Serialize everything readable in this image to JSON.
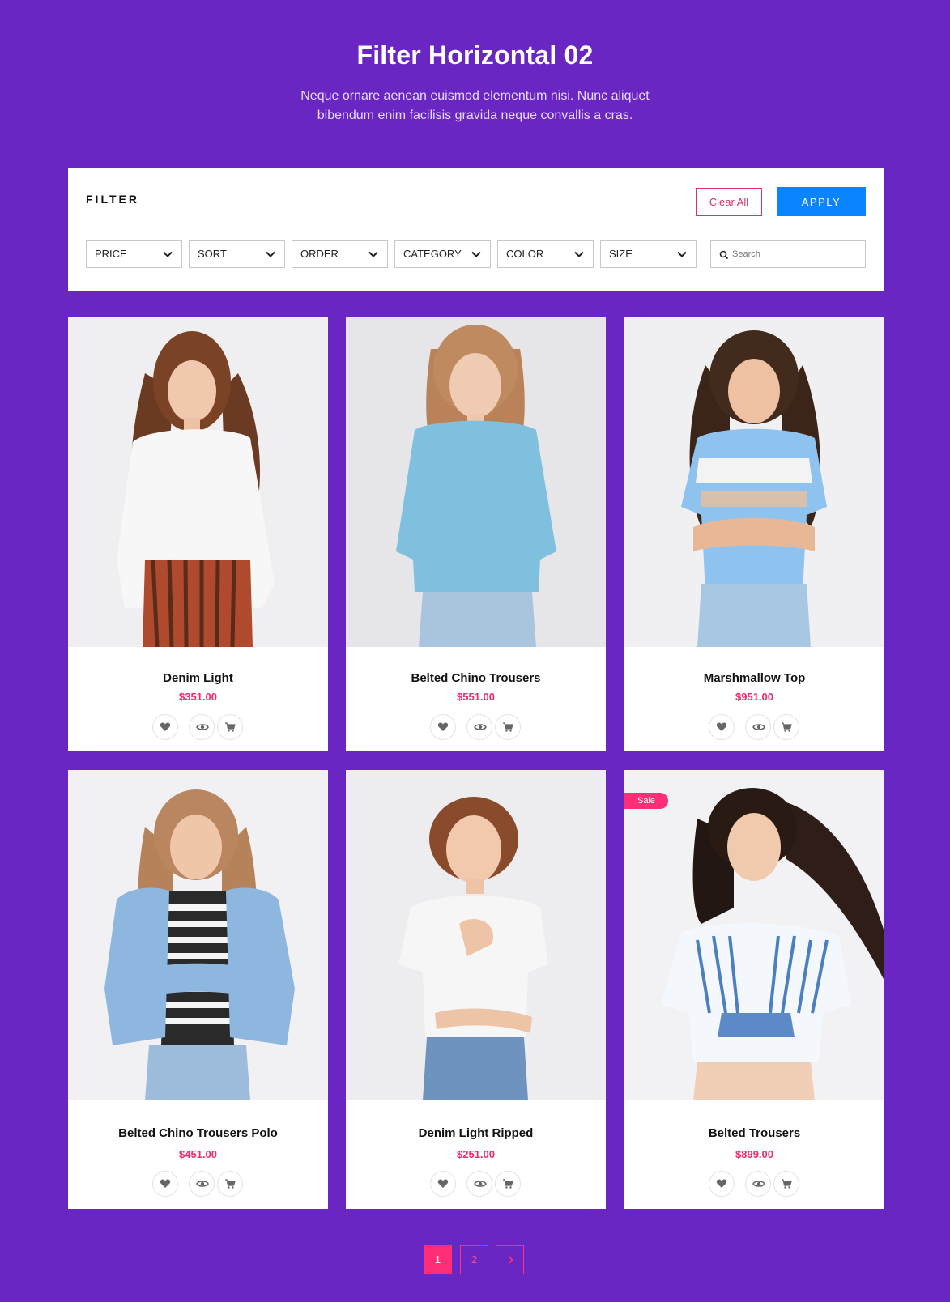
{
  "header": {
    "title": "Filter Horizontal 02",
    "subtitle": "Neque ornare aenean euismod elementum nisi. Nunc aliquet bibendum enim facilisis gravida neque convallis a cras."
  },
  "filter": {
    "title": "FILTER",
    "clear_label": "Clear All",
    "apply_label": "APPLY",
    "selects": [
      "PRICE",
      "SORT",
      "ORDER",
      "CATEGORY",
      "COLOR",
      "SIZE"
    ],
    "search_placeholder": "Search"
  },
  "products": [
    {
      "name": "Denim Light",
      "price": "$351.00",
      "sale": ""
    },
    {
      "name": "Belted Chino Trousers",
      "price": "$551.00",
      "sale": ""
    },
    {
      "name": "Marshmallow Top",
      "price": "$951.00",
      "sale": ""
    },
    {
      "name": "Belted Chino Trousers Polo",
      "price": "$451.00",
      "sale": ""
    },
    {
      "name": "Denim Light Ripped",
      "price": "$251.00",
      "sale": ""
    },
    {
      "name": "Belted Trousers",
      "price": "$899.00",
      "sale": "Sale"
    }
  ],
  "pagination": {
    "pages": [
      "1",
      "2"
    ],
    "active": "1",
    "next_icon": "chevron-right-icon"
  },
  "colors": {
    "background": "#6a26c2",
    "accent": "#ff2e76",
    "apply": "#0b84ff",
    "price": "#ee2c6a"
  }
}
